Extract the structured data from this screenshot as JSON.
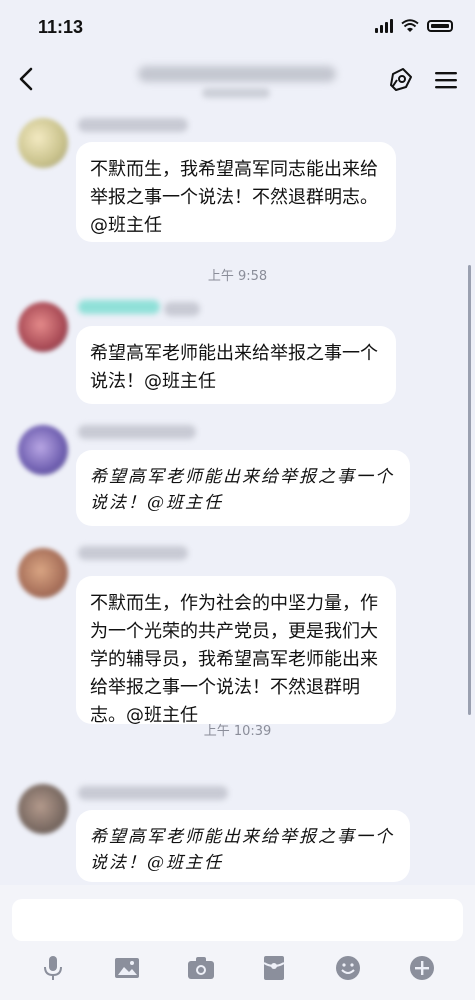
{
  "status": {
    "time": "11:13"
  },
  "nav": {
    "back_label": "<"
  },
  "messages": [
    {
      "text": "不默而生，我希望高军同志能出来给举报之事一个说法！不然退群明志。@班主任"
    },
    {
      "text": "希望高军老师能出来给举报之事一个说法！@班主任"
    },
    {
      "text": "希望高军老师能出来给举报之事一个说法！@班主任"
    },
    {
      "text": "不默而生，作为社会的中坚力量，作为一个光荣的共产党员，更是我们大学的辅导员，我希望高军老师能出来给举报之事一个说法！不然退群明志。@班主任"
    },
    {
      "text": "希望高军老师能出来给举报之事一个说法！@班主任"
    }
  ],
  "timestamps": [
    "上午 9:58",
    "上午 10:39"
  ],
  "colors": {
    "background": "#eef0f8",
    "bubble": "#ffffff",
    "input_bg": "#f3f4f9"
  },
  "icons": {
    "toolbar": [
      "microphone-icon",
      "image-icon",
      "camera-icon",
      "red-packet-icon",
      "emoji-icon",
      "plus-icon"
    ],
    "nav": [
      "announcement-icon",
      "menu-icon"
    ]
  }
}
